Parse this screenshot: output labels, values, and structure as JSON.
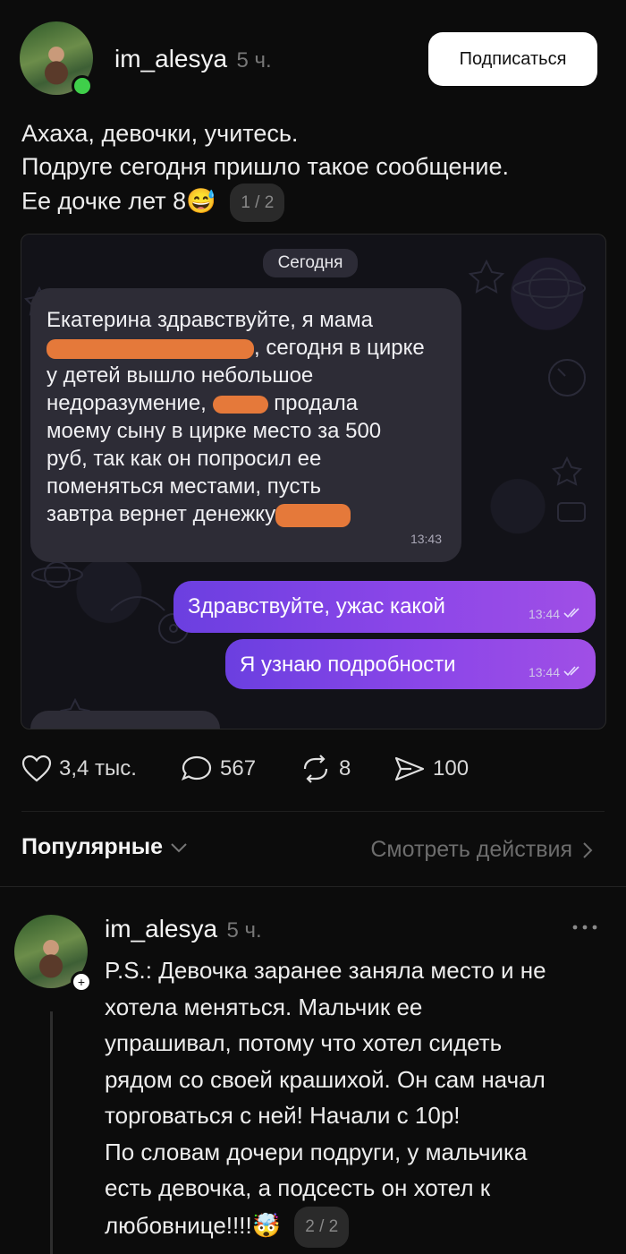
{
  "post": {
    "author": "im_alesya",
    "time": "5 ч.",
    "subscribe_label": "Подписаться",
    "text_lines": [
      "Ахаха, девочки, учитесь.",
      "Подруге сегодня пришло такое сообщение.",
      "Ее дочке лет 8"
    ],
    "emoji": "😅",
    "image_counter": "1 / 2",
    "screenshot": {
      "date_label": "Сегодня",
      "incoming": {
        "lines": [
          "Екатерина здравствуйте, я мама",
          ", сегодня в цирке",
          "у детей вышло небольшое",
          "недоразумение,",
          "продала",
          "моему сыну в цирке место за 500",
          "руб, так как он попросил ее",
          "поменяться местами, пусть",
          "завтра вернет денежку"
        ],
        "time": "13:43"
      },
      "outgoing": [
        {
          "text": "Здравствуйте, ужас какой",
          "time": "13:44"
        },
        {
          "text": "Я узнаю подробности",
          "time": "13:44"
        }
      ]
    },
    "stats": {
      "likes": "3,4 тыс.",
      "comments": "567",
      "reposts": "8",
      "shares": "100"
    }
  },
  "comments_header": {
    "sort_label": "Популярные",
    "activity_label": "Смотреть действия"
  },
  "comment": {
    "author": "im_alesya",
    "time": "5 ч.",
    "lines": [
      "P.S.: Девочка заранее заняла место и не",
      "хотела меняться. Мальчик ее",
      "упрашивал, потому что хотел сидеть",
      "рядом со своей крашихой. Он сам начал",
      "торговаться с ней! Начали с 10р!",
      "По словам дочери подруги, у мальчика",
      "есть девочка, а подсесть он хотел к",
      "любовнице!!!!"
    ],
    "emoji": "🤯",
    "image_counter": "2 / 2",
    "more_icon": "more-horizontal-icon"
  },
  "colors": {
    "background": "#0c0c0c",
    "online": "#3fcf4a",
    "outgoing_bubble": "#8b46e8",
    "redaction": "#e5793a"
  }
}
